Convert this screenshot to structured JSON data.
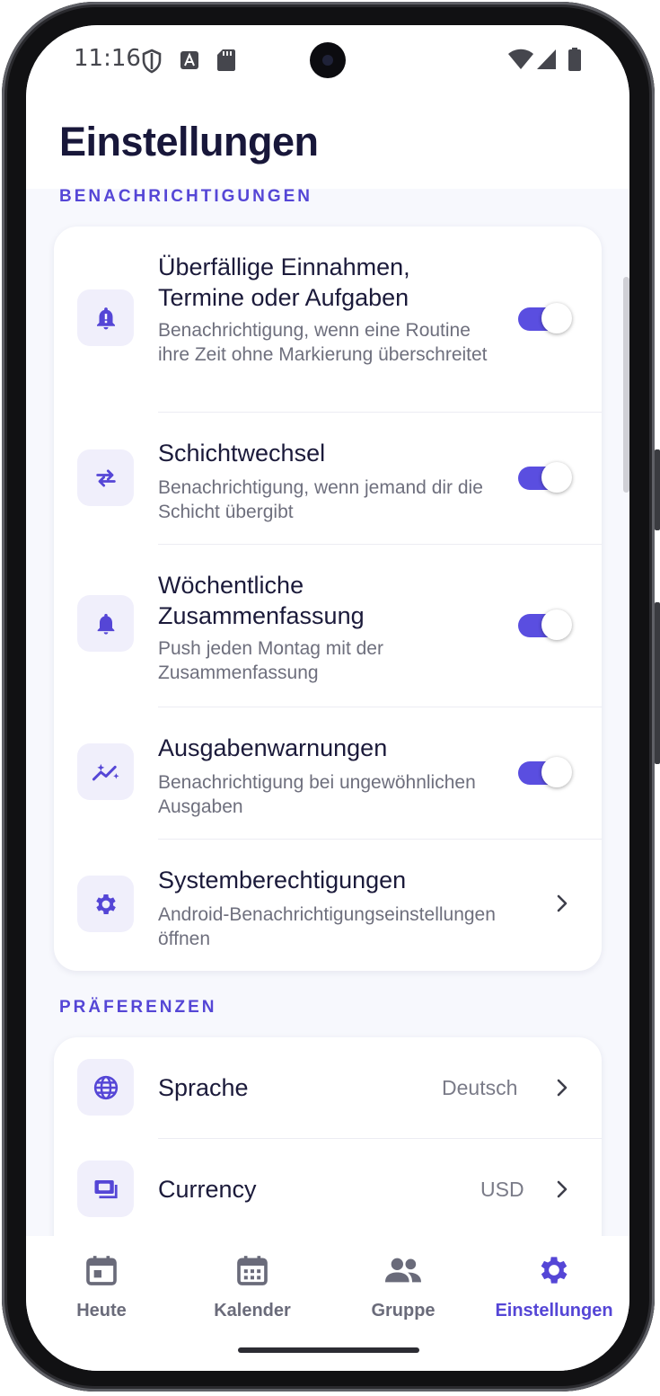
{
  "status_bar": {
    "time": "11:16"
  },
  "page": {
    "title": "Einstellungen"
  },
  "notifications": {
    "section_title": "BENACHRICHTIGUNGEN",
    "items": [
      {
        "title": "Überfällige Einnahmen, Termine oder Aufgaben",
        "description": "Benachrichtigung, wenn eine Routine ihre Zeit ohne Markierung überschreitet",
        "icon": "bell-alert-icon",
        "enabled": true
      },
      {
        "title": "Schichtwechsel",
        "description": "Benachrichtigung, wenn jemand dir die Schicht übergibt",
        "icon": "swap-arrows-icon",
        "enabled": true
      },
      {
        "title": "Wöchentliche Zusammenfassung",
        "description": "Push jeden Montag mit der Zusammenfassung",
        "icon": "bell-icon",
        "enabled": true
      },
      {
        "title": "Ausgabenwarnungen",
        "description": "Benachrichtigung bei ungewöhnlichen Ausgaben",
        "icon": "trend-sparkle-icon",
        "enabled": true
      },
      {
        "title": "Systemberechtigungen",
        "description": "Android-Benachrichtigungseinstellungen öffnen",
        "icon": "gear-icon"
      }
    ]
  },
  "preferences": {
    "section_title": "PRÄFERENZEN",
    "items": [
      {
        "title": "Sprache",
        "value": "Deutsch",
        "icon": "globe-icon"
      },
      {
        "title": "Currency",
        "value": "USD",
        "icon": "currency-icon"
      }
    ]
  },
  "nav": {
    "items": [
      {
        "label": "Heute",
        "icon": "calendar-day-icon",
        "active": false
      },
      {
        "label": "Kalender",
        "icon": "calendar-icon",
        "active": false
      },
      {
        "label": "Gruppe",
        "icon": "group-icon",
        "active": false
      },
      {
        "label": "Einstellungen",
        "icon": "gear-icon",
        "active": true
      }
    ]
  },
  "colors": {
    "accent": "#5546d6",
    "toggle_on": "#5a4ee0",
    "icon_tile": "#f0effb",
    "background": "#f7f8fd"
  }
}
